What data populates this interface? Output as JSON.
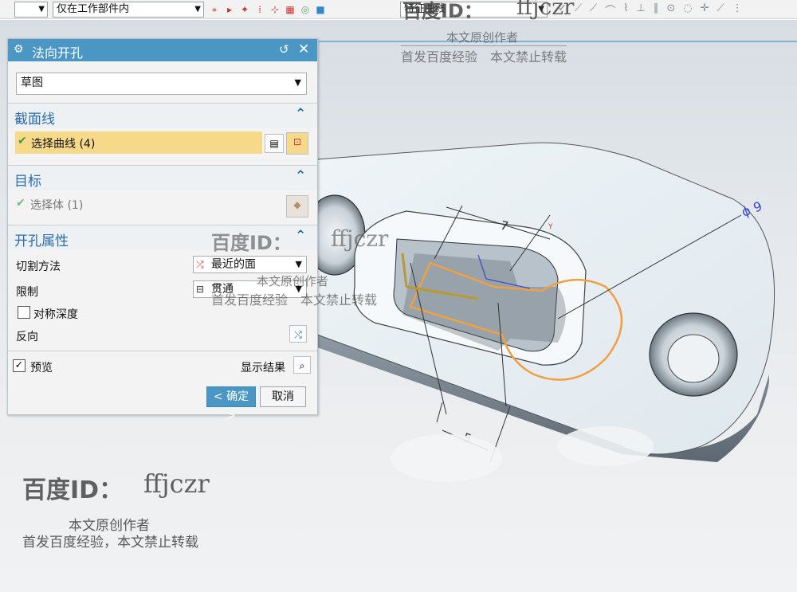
{
  "toolbar": {
    "combo_left_value": "",
    "combo_scope_value": "仅在工作部件内",
    "combo_filter_value": "特征曲线"
  },
  "dialog": {
    "title": "法向开孔",
    "type_dropdown": "草图",
    "section_curve": {
      "header": "截面线",
      "select_label": "选择曲线 (4)"
    },
    "section_target": {
      "header": "目标",
      "select_label": "选择体 (1)"
    },
    "section_props": {
      "header": "开孔属性",
      "cut_method_label": "切割方法",
      "cut_method_value": "最近的面",
      "limit_label": "限制",
      "limit_value": "贯通",
      "symmetric_depth_label": "对称深度",
      "reverse_label": "反向"
    },
    "preview_label": "预览",
    "show_result_label": "显示结果",
    "ok_label": "< 确定 >",
    "cancel_label": "取消"
  },
  "model": {
    "dim_phi": "ϕ 9",
    "dim_7": "7",
    "dim_5": "5",
    "axis_y": "Y"
  },
  "watermark": {
    "brand": "百度ID：",
    "user": "ffjczr",
    "line1": "本文原创作者",
    "line2": "首发百度经验，本文禁止转载",
    "line2_top": "首发百度经验　本文禁止转载"
  },
  "colors": {
    "title_bar": "#4a97c6",
    "selected_row": "#f7d98a",
    "section_text": "#2a6da8",
    "sketch_orange": "#f0a040"
  }
}
